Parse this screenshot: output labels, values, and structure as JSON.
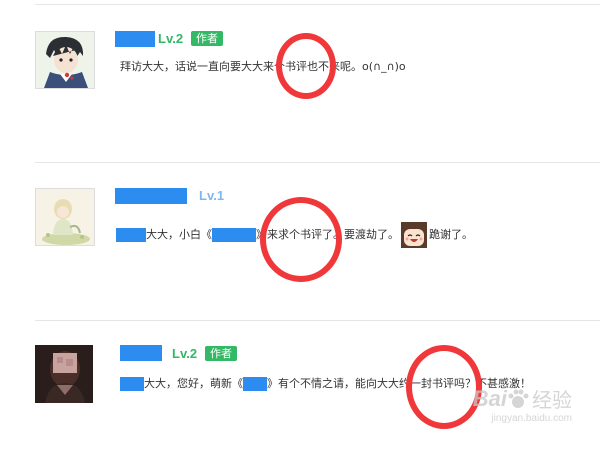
{
  "comments": [
    {
      "level": "Lv.2",
      "level_color": "#33b866",
      "badge": "作者",
      "message_parts": [
        "拜访大大，话说一直向要大大来个书评也不来呢。o(∩_∩)o"
      ]
    },
    {
      "level": "Lv.1",
      "level_color": "#7fb8f0",
      "message_parts": [
        "大大，小白《",
        "》来求个书评了。要渡劫了。",
        "跪谢了。"
      ]
    },
    {
      "level": "Lv.2",
      "level_color": "#33b866",
      "badge": "作者",
      "message_parts": [
        "大大，您好，萌新《",
        "》有个不情之请，能向大大约一封书评吗？不甚感激！"
      ]
    }
  ],
  "watermark": {
    "brand": "Bai",
    "brand_cn": "经验",
    "url": "jingyan.baidu.com"
  },
  "colors": {
    "highlight_ring": "#f0383b",
    "redacted": "#2d8cf0",
    "author_badge": "#33b866"
  },
  "icons": [
    "avatar-anime-boy",
    "avatar-girl-sitting",
    "avatar-photo-girl",
    "grinning-emoji-icon",
    "baidu-paw-icon"
  ]
}
